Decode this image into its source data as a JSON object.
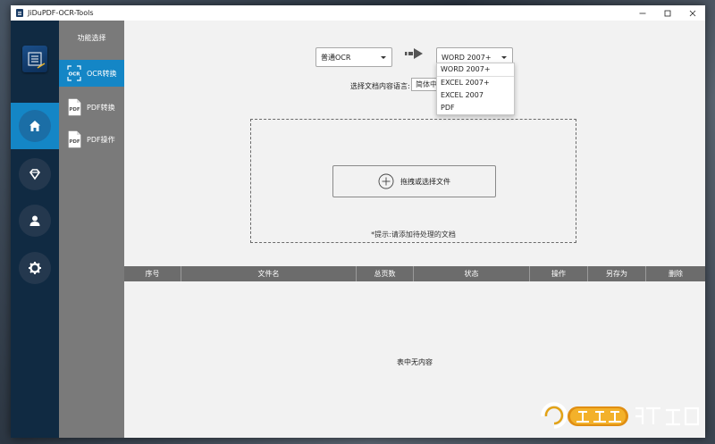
{
  "window": {
    "title": "JiDuPDF-OCR-Tools"
  },
  "sidebar": {
    "header": "功能选择",
    "items": [
      {
        "label": "OCR转换",
        "icon": "ocr-icon",
        "active": true
      },
      {
        "label": "PDF转换",
        "icon": "pdf-icon",
        "active": false
      },
      {
        "label": "PDF操作",
        "icon": "pdf-icon",
        "active": false
      }
    ]
  },
  "leftnav": {
    "items": [
      "home-icon",
      "diamond-icon",
      "user-icon",
      "gear-icon"
    ],
    "active": "home-icon"
  },
  "converter": {
    "source_value": "普通OCR",
    "target_value": "WORD 2007+",
    "target_options": [
      "WORD 2007+",
      "EXCEL 2007+",
      "EXCEL 2007",
      "PDF"
    ],
    "lang_label": "选择文档内容语言:",
    "lang_value": "简体中文"
  },
  "dropzone": {
    "button_label": "拖拽或选择文件",
    "hint": "*提示:请添加待处理的文档"
  },
  "table": {
    "columns": [
      "序号",
      "文件名",
      "总页数",
      "状态",
      "操作",
      "另存为",
      "删除"
    ],
    "empty_text": "表中无内容"
  },
  "colors": {
    "accent": "#1486c6",
    "leftbar": "#102a42",
    "sidebar": "#7a7a7a",
    "table_header": "#6c6c6c"
  }
}
